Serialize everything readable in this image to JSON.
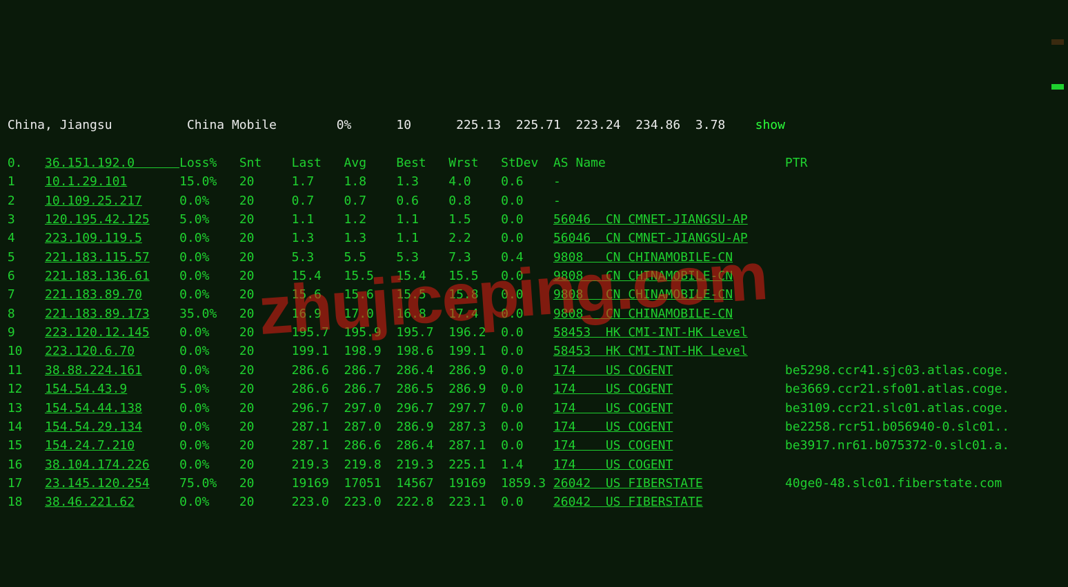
{
  "summary": {
    "location": "China, Jiangsu",
    "provider": "China Mobile",
    "loss": "0%",
    "snt": "10",
    "last": "225.13",
    "avg": "225.71",
    "best": "223.24",
    "wrst": "234.86",
    "stdev": "3.78",
    "action": "show"
  },
  "header": {
    "hop": "0.",
    "target": "36.151.192.0",
    "loss": "Loss%",
    "snt": "Snt",
    "last": "Last",
    "avg": "Avg",
    "best": "Best",
    "wrst": "Wrst",
    "stdev": "StDev",
    "asname": "AS Name",
    "ptr": "PTR"
  },
  "hops": [
    {
      "n": "1",
      "host": "10.1.29.101",
      "loss": "15.0%",
      "snt": "20",
      "last": "1.7",
      "avg": "1.8",
      "best": "1.3",
      "wrst": "4.0",
      "stdev": "0.6",
      "asn": "-",
      "asname": "",
      "ptr": ""
    },
    {
      "n": "2",
      "host": "10.109.25.217",
      "loss": "0.0%",
      "snt": "20",
      "last": "0.7",
      "avg": "0.7",
      "best": "0.6",
      "wrst": "0.8",
      "stdev": "0.0",
      "asn": "-",
      "asname": "",
      "ptr": ""
    },
    {
      "n": "3",
      "host": "120.195.42.125",
      "loss": "5.0%",
      "snt": "20",
      "last": "1.1",
      "avg": "1.2",
      "best": "1.1",
      "wrst": "1.5",
      "stdev": "0.0",
      "asn": "56046",
      "loc": "CN",
      "asname": "CMNET-JIANGSU-AP",
      "ptr": ""
    },
    {
      "n": "4",
      "host": "223.109.119.5",
      "loss": "0.0%",
      "snt": "20",
      "last": "1.3",
      "avg": "1.3",
      "best": "1.1",
      "wrst": "2.2",
      "stdev": "0.0",
      "asn": "56046",
      "loc": "CN",
      "asname": "CMNET-JIANGSU-AP",
      "ptr": ""
    },
    {
      "n": "5",
      "host": "221.183.115.57",
      "loss": "0.0%",
      "snt": "20",
      "last": "5.3",
      "avg": "5.5",
      "best": "5.3",
      "wrst": "7.3",
      "stdev": "0.4",
      "asn": "9808",
      "loc": "CN",
      "asname": "CHINAMOBILE-CN",
      "ptr": ""
    },
    {
      "n": "6",
      "host": "221.183.136.61",
      "loss": "0.0%",
      "snt": "20",
      "last": "15.4",
      "avg": "15.5",
      "best": "15.4",
      "wrst": "15.5",
      "stdev": "0.0",
      "asn": "9808",
      "loc": "CN",
      "asname": "CHINAMOBILE-CN",
      "ptr": ""
    },
    {
      "n": "7",
      "host": "221.183.89.70",
      "loss": "0.0%",
      "snt": "20",
      "last": "15.6",
      "avg": "15.6",
      "best": "15.5",
      "wrst": "15.8",
      "stdev": "0.0",
      "asn": "9808",
      "loc": "CN",
      "asname": "CHINAMOBILE-CN",
      "ptr": ""
    },
    {
      "n": "8",
      "host": "221.183.89.173",
      "loss": "35.0%",
      "snt": "20",
      "last": "16.9",
      "avg": "17.0",
      "best": "16.8",
      "wrst": "17.4",
      "stdev": "0.0",
      "asn": "9808",
      "loc": "CN",
      "asname": "CHINAMOBILE-CN",
      "ptr": ""
    },
    {
      "n": "9",
      "host": "223.120.12.145",
      "loss": "0.0%",
      "snt": "20",
      "last": "195.7",
      "avg": "195.9",
      "best": "195.7",
      "wrst": "196.2",
      "stdev": "0.0",
      "asn": "58453",
      "loc": "HK",
      "asname": "CMI-INT-HK Level",
      "ptr": ""
    },
    {
      "n": "10",
      "host": "223.120.6.70",
      "loss": "0.0%",
      "snt": "20",
      "last": "199.1",
      "avg": "198.9",
      "best": "198.6",
      "wrst": "199.1",
      "stdev": "0.0",
      "asn": "58453",
      "loc": "HK",
      "asname": "CMI-INT-HK Level",
      "ptr": ""
    },
    {
      "n": "11",
      "host": "38.88.224.161",
      "loss": "0.0%",
      "snt": "20",
      "last": "286.6",
      "avg": "286.7",
      "best": "286.4",
      "wrst": "286.9",
      "stdev": "0.0",
      "asn": "174",
      "loc": "US",
      "asname": "COGENT",
      "ptr": "be5298.ccr41.sjc03.atlas.coge."
    },
    {
      "n": "12",
      "host": "154.54.43.9",
      "loss": "5.0%",
      "snt": "20",
      "last": "286.6",
      "avg": "286.7",
      "best": "286.5",
      "wrst": "286.9",
      "stdev": "0.0",
      "asn": "174",
      "loc": "US",
      "asname": "COGENT",
      "ptr": "be3669.ccr21.sfo01.atlas.coge."
    },
    {
      "n": "13",
      "host": "154.54.44.138",
      "loss": "0.0%",
      "snt": "20",
      "last": "296.7",
      "avg": "297.0",
      "best": "296.7",
      "wrst": "297.7",
      "stdev": "0.0",
      "asn": "174",
      "loc": "US",
      "asname": "COGENT",
      "ptr": "be3109.ccr21.slc01.atlas.coge."
    },
    {
      "n": "14",
      "host": "154.54.29.134",
      "loss": "0.0%",
      "snt": "20",
      "last": "287.1",
      "avg": "287.0",
      "best": "286.9",
      "wrst": "287.3",
      "stdev": "0.0",
      "asn": "174",
      "loc": "US",
      "asname": "COGENT",
      "ptr": "be2258.rcr51.b056940-0.slc01.."
    },
    {
      "n": "15",
      "host": "154.24.7.210",
      "loss": "0.0%",
      "snt": "20",
      "last": "287.1",
      "avg": "286.6",
      "best": "286.4",
      "wrst": "287.1",
      "stdev": "0.0",
      "asn": "174",
      "loc": "US",
      "asname": "COGENT",
      "ptr": "be3917.nr61.b075372-0.slc01.a."
    },
    {
      "n": "16",
      "host": "38.104.174.226",
      "loss": "0.0%",
      "snt": "20",
      "last": "219.3",
      "avg": "219.8",
      "best": "219.3",
      "wrst": "225.1",
      "stdev": "1.4",
      "asn": "174",
      "loc": "US",
      "asname": "COGENT",
      "ptr": ""
    },
    {
      "n": "17",
      "host": "23.145.120.254",
      "loss": "75.0%",
      "snt": "20",
      "last": "19169",
      "avg": "17051",
      "best": "14567",
      "wrst": "19169",
      "stdev": "1859.3",
      "asn": "26042",
      "loc": "US",
      "asname": "FIBERSTATE",
      "ptr": "40ge0-48.slc01.fiberstate.com"
    },
    {
      "n": "18",
      "host": "38.46.221.62",
      "loss": "0.0%",
      "snt": "20",
      "last": "223.0",
      "avg": "223.0",
      "best": "222.8",
      "wrst": "223.1",
      "stdev": "0.0",
      "asn": "26042",
      "loc": "US",
      "asname": "FIBERSTATE",
      "ptr": ""
    }
  ],
  "watermark": "zhujiceping.com",
  "cols": {
    "hop": 5,
    "host": 18,
    "loss": 8,
    "snt": 7,
    "last": 7,
    "avg": 7,
    "best": 7,
    "wrst": 7,
    "stdev": 7,
    "asn": 7,
    "loc": 3,
    "asname": 20
  }
}
